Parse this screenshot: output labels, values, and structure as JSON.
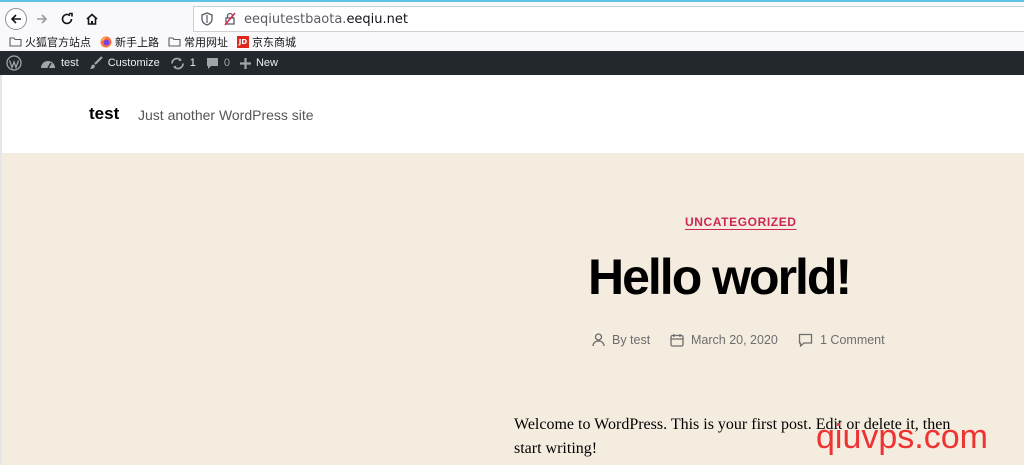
{
  "browser": {
    "url_prefix": "eeqiutestbaota.",
    "url_domain": "eeqiu.net"
  },
  "bookmarks": [
    {
      "label": "火狐官方站点",
      "icon": "folder-icon"
    },
    {
      "label": "新手上路",
      "icon": "firefox-icon"
    },
    {
      "label": "常用网址",
      "icon": "folder-icon"
    },
    {
      "label": "京东商城",
      "icon": "jd-icon",
      "badge": "JD"
    }
  ],
  "adminbar": {
    "site": "test",
    "customize": "Customize",
    "updates_count": "1",
    "comments_count": "0",
    "new": "New"
  },
  "site": {
    "title": "test",
    "description": "Just another WordPress site"
  },
  "post": {
    "category": "UNCATEGORIZED",
    "title": "Hello world!",
    "author": "By test",
    "date": "March 20, 2020",
    "comments": "1 Comment",
    "body": "Welcome to WordPress. This is your first post. Edit or delete it, then start writing!"
  },
  "watermark": "qiuvps.com",
  "colors": {
    "accent": "#cd2653",
    "adminbar": "#23282d",
    "background": "#f4ecdf"
  }
}
